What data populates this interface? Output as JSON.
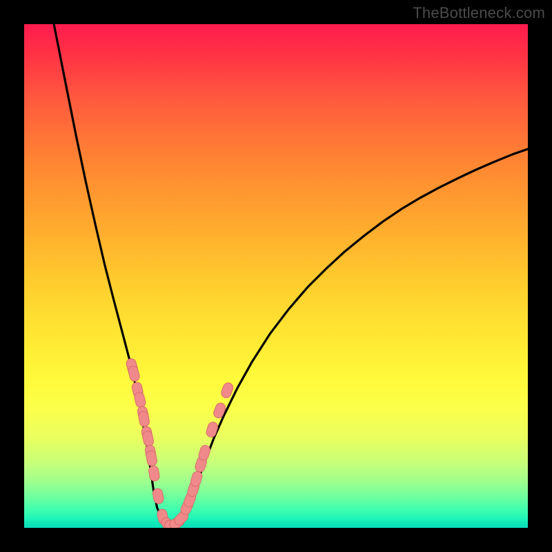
{
  "watermark": "TheBottleneck.com",
  "colors": {
    "curve": "#000000",
    "bead_fill": "#f08a8a",
    "bead_stroke": "#d86a6a",
    "frame": "#000000"
  },
  "chart_data": {
    "type": "line",
    "title": "",
    "xlabel": "",
    "ylabel": "",
    "xlim": [
      0,
      100
    ],
    "ylim": [
      0,
      100
    ],
    "grid": false,
    "legend": false,
    "annotations": [],
    "note": "Decorative bottleneck-style V curve on a rainbow gradient; no numeric axis ticks or data labels are shown in the image, so values are read off the pixel y-position as a proxy for magnitude (0 = bottom/green, 100 = top/red).",
    "series": [
      {
        "name": "curve",
        "type": "line",
        "x": [
          5.9,
          8.2,
          10.3,
          12.3,
          14.2,
          16.0,
          17.8,
          19.5,
          21.1,
          22.3,
          23.2,
          24.0,
          24.7,
          25.2,
          25.7,
          26.4,
          27.4,
          28.6,
          29.8,
          31.0,
          32.2,
          33.4,
          34.6,
          35.9,
          37.7,
          39.7,
          42.3,
          45.2,
          48.8,
          52.5,
          56.2,
          60.0,
          63.7,
          67.5,
          71.2,
          74.9,
          78.6,
          82.3,
          86.1,
          89.7,
          93.4,
          97.1,
          100.0
        ],
        "y": [
          100.0,
          88.4,
          77.9,
          68.4,
          59.9,
          52.2,
          45.2,
          38.8,
          32.7,
          27.5,
          22.8,
          18.4,
          14.4,
          10.8,
          7.4,
          4.0,
          1.7,
          0.5,
          0.5,
          1.4,
          3.4,
          6.2,
          9.7,
          13.2,
          17.9,
          22.4,
          27.7,
          32.9,
          38.5,
          43.4,
          47.7,
          51.5,
          54.9,
          58.0,
          60.8,
          63.3,
          65.5,
          67.5,
          69.4,
          71.1,
          72.7,
          74.2,
          75.2
        ]
      },
      {
        "name": "beads",
        "type": "scatter",
        "x": [
          21.4,
          21.8,
          22.5,
          23.0,
          23.6,
          23.8,
          24.4,
          24.6,
          25.1,
          25.3,
          25.8,
          26.6,
          27.5,
          28.5,
          29.4,
          30.3,
          31.2,
          32.3,
          32.9,
          33.6,
          34.2,
          35.1,
          35.8,
          37.3,
          38.8,
          40.3
        ],
        "y": [
          32.1,
          30.6,
          27.4,
          25.4,
          22.6,
          21.6,
          18.6,
          17.7,
          14.9,
          13.8,
          10.8,
          6.3,
          2.2,
          0.6,
          0.5,
          1.0,
          1.9,
          4.1,
          5.6,
          7.7,
          9.7,
          12.6,
          14.9,
          19.5,
          23.3,
          27.3
        ]
      }
    ]
  }
}
